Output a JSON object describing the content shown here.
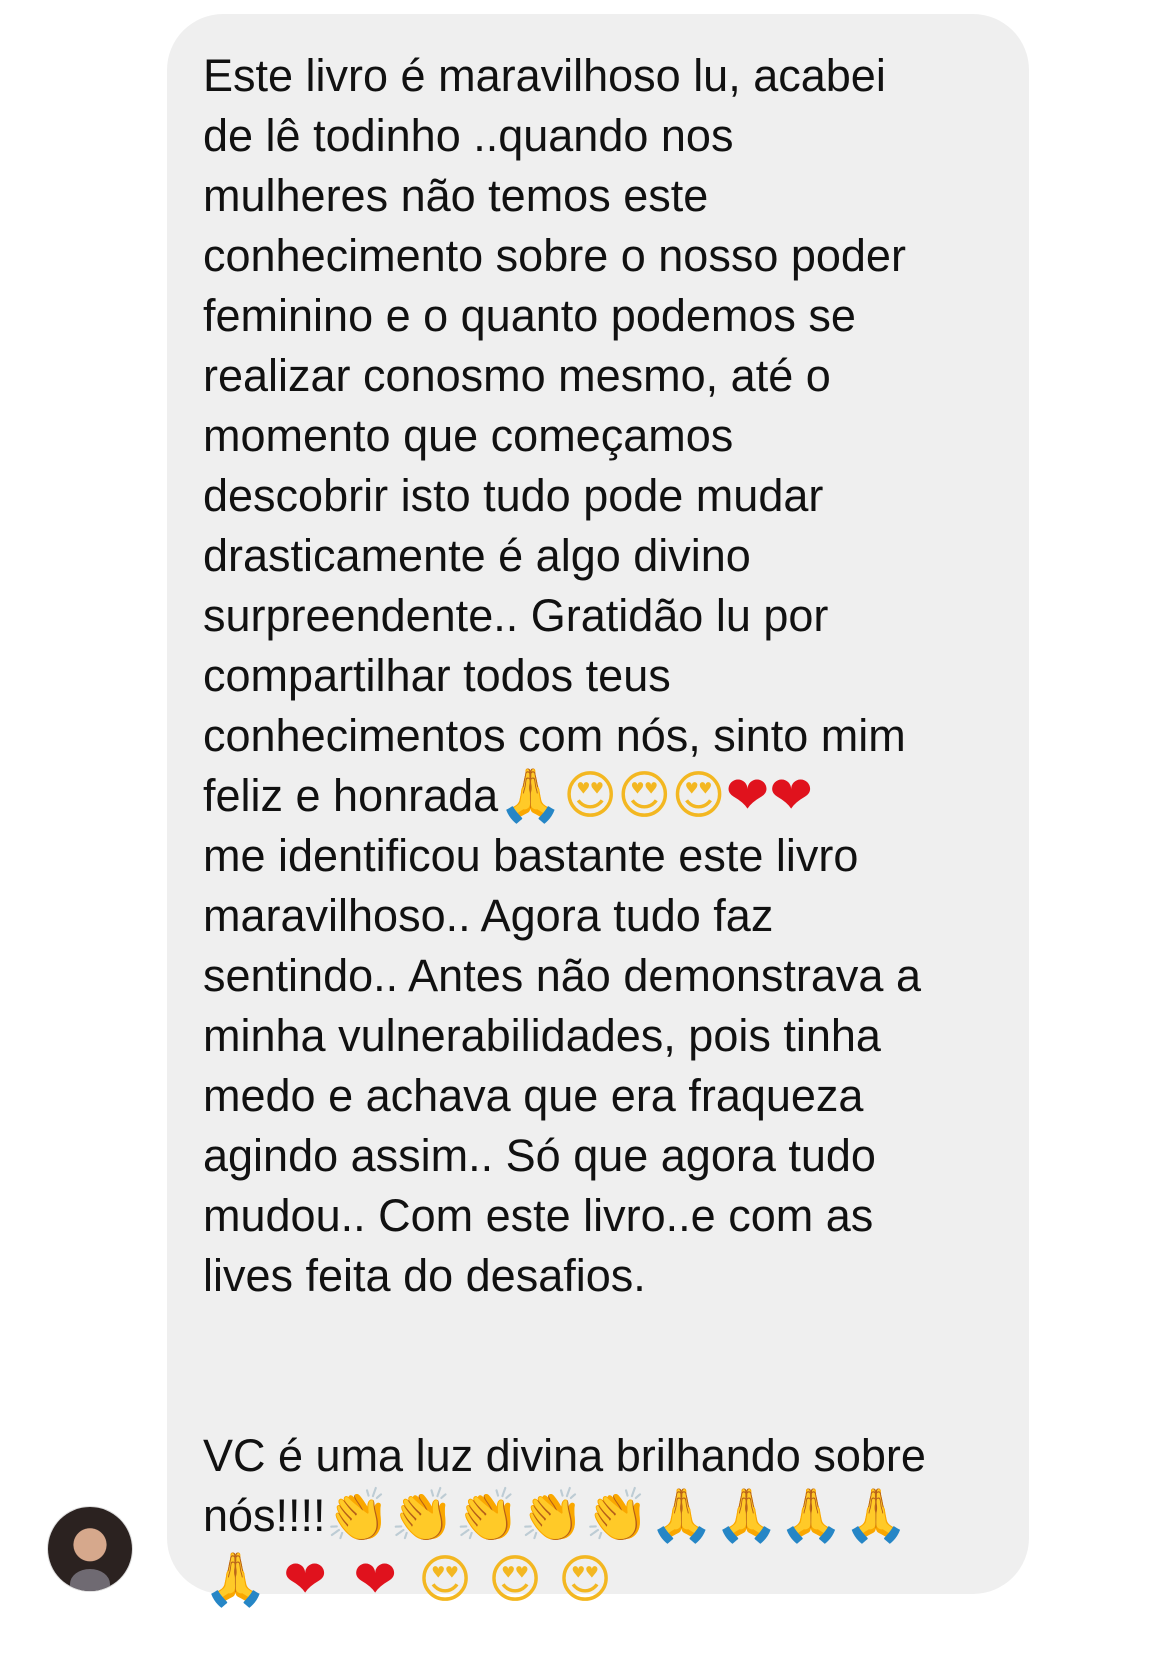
{
  "message": {
    "lines": [
      "Este livro é maravilhoso lu, acabei",
      "de lê todinho ..quando nos",
      "mulheres não temos este",
      "conhecimento sobre o nosso poder",
      "feminino e o quanto podemos se",
      "realizar conosmo mesmo, até o",
      "momento que começamos",
      "descobrir isto tudo pode mudar",
      "drasticamente é algo divino",
      "surpreendente.. Gratidão lu por",
      "compartilhar todos teus",
      "conhecimentos com nós, sinto mim",
      "feliz e honrada",
      "me identificou bastante este livro",
      "maravilhoso.. Agora tudo faz",
      "sentindo.. Antes não demonstrava a",
      "minha vulnerabilidades, pois tinha",
      "medo e achava que era fraqueza",
      "agindo assim.. Só que agora tudo",
      "mudou.. Com este livro..e com as",
      "lives feita do desafios."
    ],
    "closing_line": "VC é uma luz divina brilhando sobre",
    "closing_tail": "nós!!!!"
  },
  "emojis": {
    "pray": "🙏",
    "heart_eyes": "😍",
    "heart": "❤",
    "clap": "👏"
  },
  "avatar": {
    "icon": "profile-photo"
  }
}
